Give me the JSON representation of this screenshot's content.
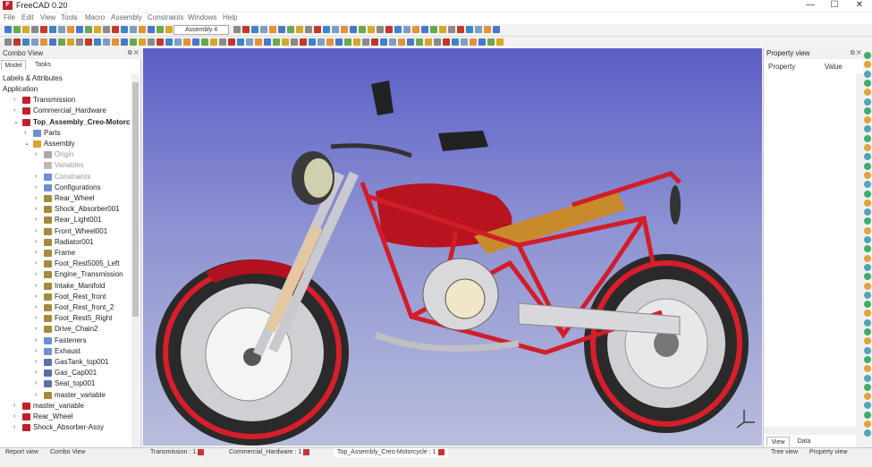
{
  "window": {
    "title": "FreeCAD 0.20",
    "controls": [
      "—",
      "☐",
      "✕"
    ]
  },
  "menu": [
    "File",
    "Edit",
    "View",
    "Tools",
    "Macro",
    "Assembly",
    "Constraints",
    "Windows",
    "Help"
  ],
  "toolbar": {
    "assembly_select": "Assembly 4"
  },
  "combo_view": {
    "title": "Combo View",
    "tabs": [
      "Model",
      "Tasks"
    ],
    "section_label": "Labels & Attributes",
    "tree": [
      {
        "label": "Application",
        "level": 0,
        "arrow": "",
        "icon": ""
      },
      {
        "label": "Transmission",
        "level": 1,
        "arrow": "›",
        "icon": "part-icon"
      },
      {
        "label": "Commercial_Hardware",
        "level": 1,
        "arrow": "›",
        "icon": "part-icon"
      },
      {
        "label": "Top_Assembly_Creo-Motorcycle",
        "level": 1,
        "arrow": "⌄",
        "icon": "part-icon",
        "bold": true
      },
      {
        "label": "Parts",
        "level": 2,
        "arrow": "›",
        "icon": "folder-icon"
      },
      {
        "label": "Assembly",
        "level": 2,
        "arrow": "⌄",
        "icon": "assembly-icon"
      },
      {
        "label": "Origin",
        "level": 3,
        "arrow": "›",
        "icon": "origin-icon",
        "dim": true
      },
      {
        "label": "Variables",
        "level": 3,
        "arrow": "",
        "icon": "variables-icon",
        "dim": true
      },
      {
        "label": "Constraints",
        "level": 3,
        "arrow": "›",
        "icon": "folder-icon",
        "dim": true
      },
      {
        "label": "Configurations",
        "level": 3,
        "arrow": "›",
        "icon": "folder-icon"
      },
      {
        "label": "Rear_Wheel",
        "level": 3,
        "arrow": "›",
        "icon": "link-icon"
      },
      {
        "label": "Shock_Absorber001",
        "level": 3,
        "arrow": "›",
        "icon": "link-icon"
      },
      {
        "label": "Rear_Light001",
        "level": 3,
        "arrow": "›",
        "icon": "link-icon"
      },
      {
        "label": "Front_Wheel001",
        "level": 3,
        "arrow": "›",
        "icon": "link-icon"
      },
      {
        "label": "Radiator001",
        "level": 3,
        "arrow": "›",
        "icon": "link-icon"
      },
      {
        "label": "Frame",
        "level": 3,
        "arrow": "›",
        "icon": "link-icon"
      },
      {
        "label": "Foot_Rest5005_Left",
        "level": 3,
        "arrow": "›",
        "icon": "link-icon"
      },
      {
        "label": "Engine_Transmission",
        "level": 3,
        "arrow": "›",
        "icon": "link-icon"
      },
      {
        "label": "Intake_Manifold",
        "level": 3,
        "arrow": "›",
        "icon": "link-icon"
      },
      {
        "label": "Foot_Rest_front",
        "level": 3,
        "arrow": "›",
        "icon": "link-icon"
      },
      {
        "label": "Foot_Rest_front_2",
        "level": 3,
        "arrow": "›",
        "icon": "link-icon"
      },
      {
        "label": "Foot_Rest5_Right",
        "level": 3,
        "arrow": "›",
        "icon": "link-icon"
      },
      {
        "label": "Drive_Chain2",
        "level": 3,
        "arrow": "›",
        "icon": "link-icon"
      },
      {
        "label": "Fasteners",
        "level": 3,
        "arrow": "›",
        "icon": "folder-icon"
      },
      {
        "label": "Exhaust",
        "level": 3,
        "arrow": "›",
        "icon": "folder-icon"
      },
      {
        "label": "GasTank_top001",
        "level": 3,
        "arrow": "›",
        "icon": "body-icon"
      },
      {
        "label": "Gas_Cap001",
        "level": 3,
        "arrow": "›",
        "icon": "body-icon"
      },
      {
        "label": "Seat_top001",
        "level": 3,
        "arrow": "›",
        "icon": "body-icon"
      },
      {
        "label": "master_variable",
        "level": 3,
        "arrow": "›",
        "icon": "link-icon"
      },
      {
        "label": "master_variable",
        "level": 1,
        "arrow": "›",
        "icon": "part-icon"
      },
      {
        "label": "Rear_Wheel",
        "level": 1,
        "arrow": "›",
        "icon": "part-icon"
      },
      {
        "label": "Shock_Absorber-Assy",
        "level": 1,
        "arrow": "›",
        "icon": "part-icon"
      }
    ]
  },
  "property_view": {
    "title": "Property view",
    "columns": [
      "Property",
      "Value"
    ],
    "tabs": [
      "View",
      "Data"
    ]
  },
  "bottom_tabs": {
    "left": [
      "Report view",
      "Combo View"
    ],
    "documents": [
      "Transmission : 1",
      "Commercial_Hardware : 1",
      "Top_Assembly_Creo-Motorcycle : 1"
    ],
    "right": [
      "Tree view",
      "Property view"
    ]
  },
  "colors": {
    "frame_red": "#c41e2a",
    "viewport_top": "#5c5ec6",
    "viewport_bottom": "#b9bddc",
    "freecad_red": "#c0202a"
  }
}
